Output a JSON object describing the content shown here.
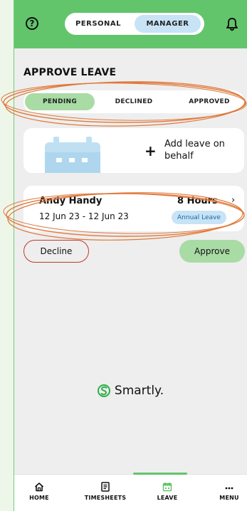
{
  "header": {
    "toggle": {
      "personal": "PERSONAL",
      "manager": "MANAGER"
    }
  },
  "main": {
    "section_title": "APPROVE LEAVE",
    "filter_tabs": [
      "PENDING",
      "DECLINED",
      "APPROVED"
    ],
    "active_filter": "PENDING",
    "add_leave": {
      "label": "Add leave on behalf"
    },
    "leave_request": {
      "employee": "Andy Handy",
      "hours": "8 Hours",
      "chevron": "›",
      "dates": "12 Jun 23 - 12 Jun 23",
      "type": "Annual Leave"
    },
    "actions": {
      "decline": "Decline",
      "approve": "Approve"
    }
  },
  "brand": {
    "name": "Smartly."
  },
  "bottom_nav": {
    "items": [
      {
        "label": "HOME",
        "icon": "home-icon"
      },
      {
        "label": "TIMESHEETS",
        "icon": "timesheets-icon"
      },
      {
        "label": "LEAVE",
        "icon": "calendar-icon",
        "active": true
      },
      {
        "label": "MENU",
        "icon": "more-icon"
      }
    ]
  },
  "colors": {
    "brand_green": "#62c56b",
    "light_green": "#a9dba5",
    "light_blue": "#c8e3f6",
    "annotation_orange": "#e0783a"
  }
}
